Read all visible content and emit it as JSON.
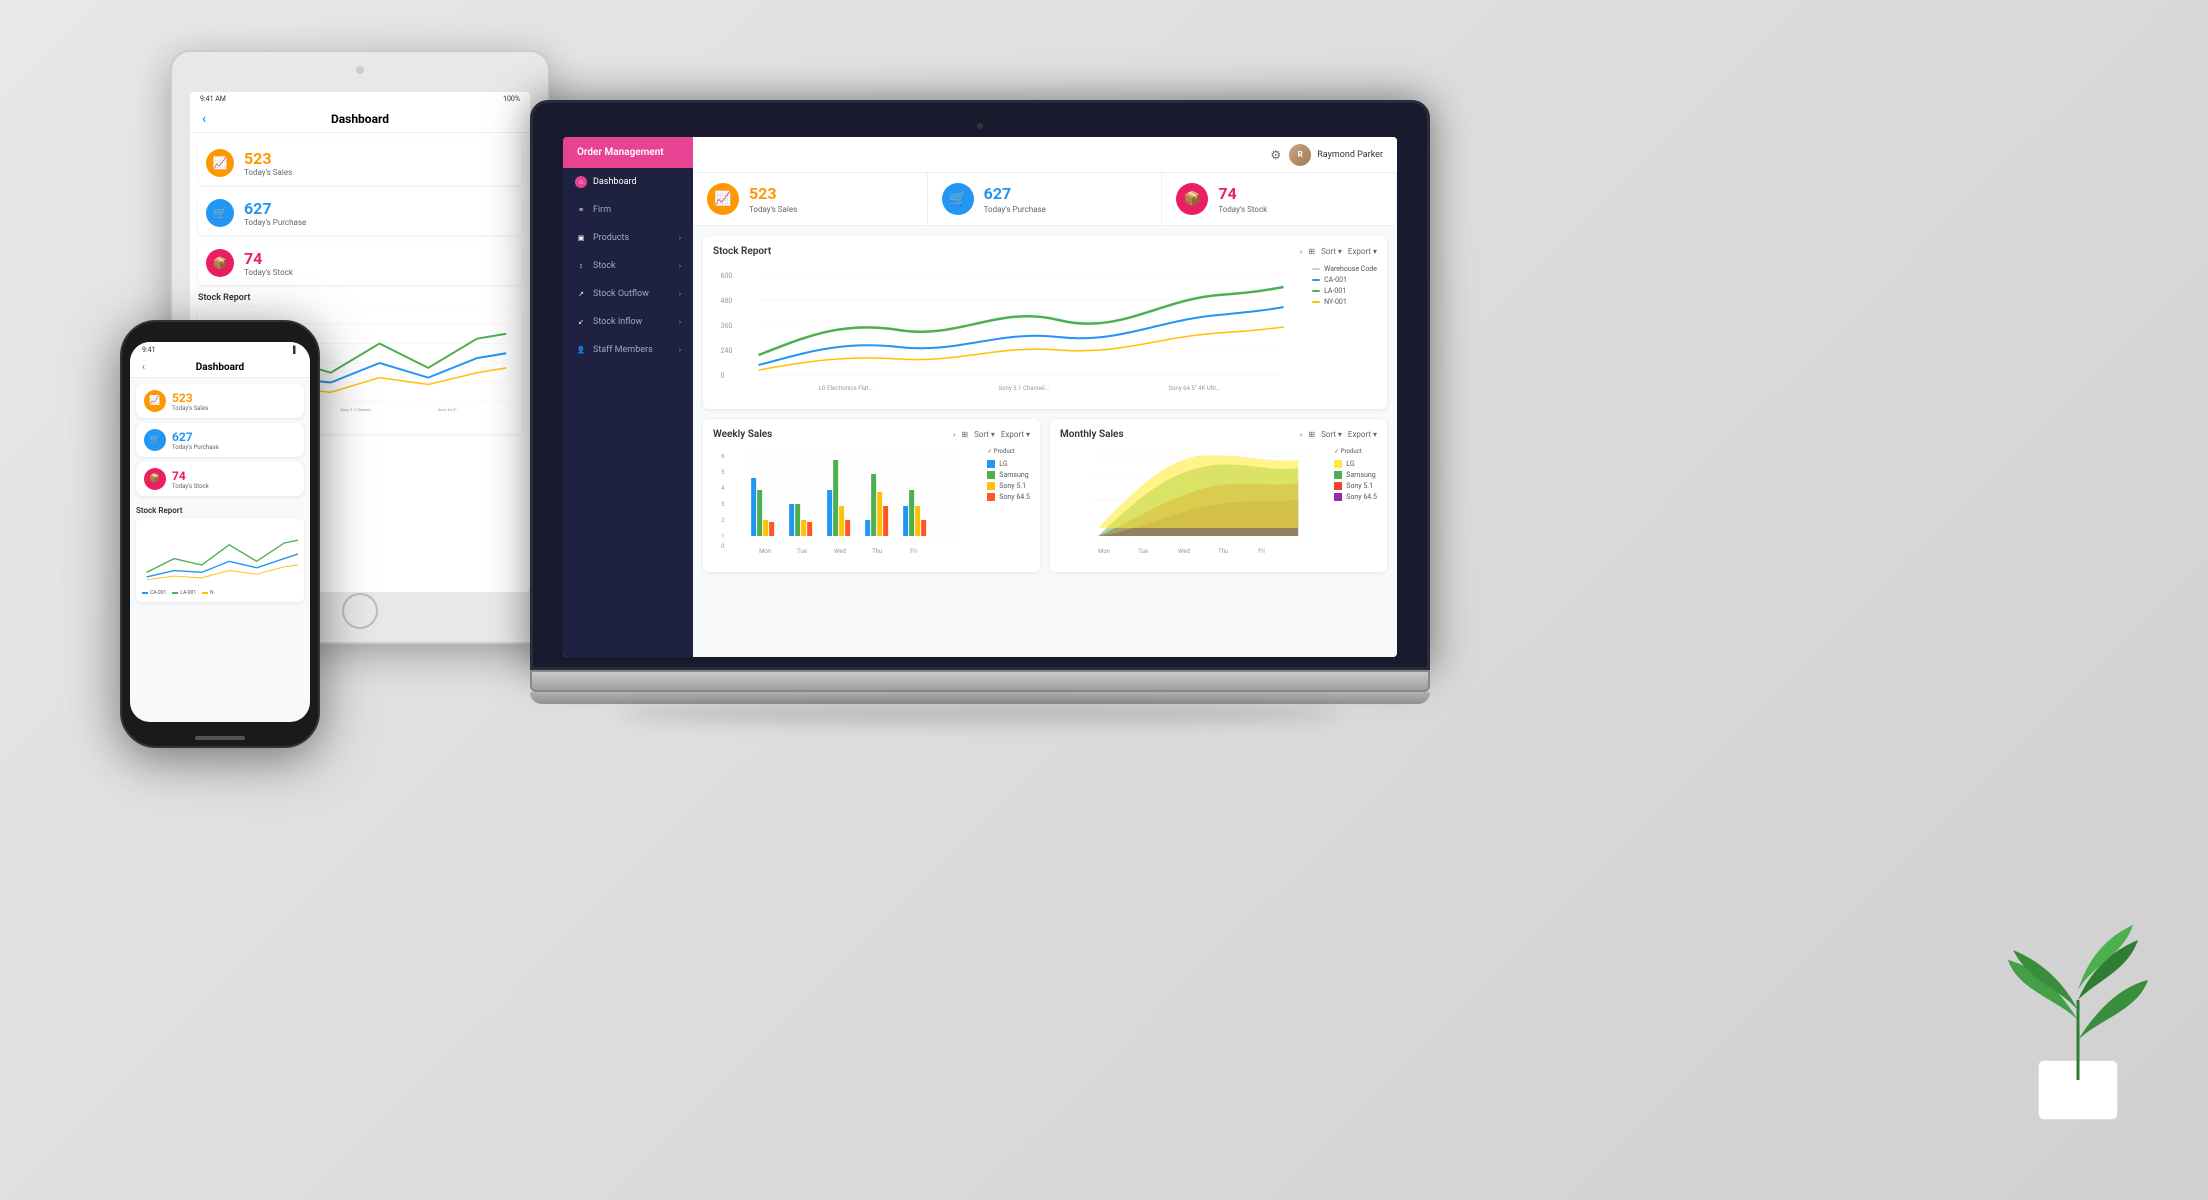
{
  "app": {
    "title": "Order Management"
  },
  "sidebar": {
    "header": "Order Management",
    "items": [
      {
        "label": "Dashboard",
        "icon": "🏠",
        "active": true
      },
      {
        "label": "Firm",
        "icon": "📋",
        "active": false
      },
      {
        "label": "Products",
        "icon": "📦",
        "active": false,
        "has_arrow": true
      },
      {
        "label": "Stock",
        "icon": "📊",
        "active": false,
        "has_arrow": true
      },
      {
        "label": "Stock Outflow",
        "icon": "📈",
        "active": false,
        "has_arrow": true
      },
      {
        "label": "Stock Inflow",
        "icon": "📉",
        "active": false,
        "has_arrow": true
      },
      {
        "label": "Staff Members",
        "icon": "👥",
        "active": false,
        "has_arrow": true
      }
    ]
  },
  "header": {
    "user_name": "Raymond Parker",
    "gear_icon": "⚙"
  },
  "stats": [
    {
      "value": "523",
      "label": "Today's Sales",
      "color": "orange",
      "icon": "📈"
    },
    {
      "value": "627",
      "label": "Today's Purchase",
      "color": "blue",
      "icon": "🛒"
    },
    {
      "value": "74",
      "label": "Today's Stock",
      "color": "pink",
      "icon": "📦"
    }
  ],
  "stock_report": {
    "title": "Stock Report",
    "sort_label": "Sort",
    "export_label": "Export",
    "y_labels": [
      "600",
      "480",
      "360",
      "240",
      "0"
    ],
    "x_labels": [
      "LG Electronics Flat...",
      "Sony 5.1 Channel...",
      "Sony 64.5\" 4K Ultr..."
    ],
    "legend": [
      {
        "label": "Warehouse Code",
        "color": "#ccc"
      },
      {
        "label": "CA-001",
        "color": "#2196f3"
      },
      {
        "label": "LA-001",
        "color": "#4caf50"
      },
      {
        "label": "NY-001",
        "color": "#ffeb3b"
      }
    ]
  },
  "weekly_sales": {
    "title": "Weekly Sales",
    "sort_label": "Sort",
    "export_label": "Export",
    "x_labels": [
      "Mon",
      "Tue",
      "Wed",
      "Thu",
      "Fri"
    ],
    "y_labels": [
      "6",
      "5",
      "4",
      "3",
      "2",
      "1",
      "0"
    ],
    "legend": [
      {
        "label": "LG",
        "color": "#2196f3"
      },
      {
        "label": "Samsung",
        "color": "#4caf50"
      },
      {
        "label": "Sony 5.1",
        "color": "#ffeb3b"
      },
      {
        "label": "Sony 64.5",
        "color": "#ff5722"
      }
    ],
    "bars": {
      "Mon": [
        4,
        3,
        1,
        1
      ],
      "Tue": [
        2,
        2,
        1,
        1
      ],
      "Wed": [
        3,
        5,
        2,
        1
      ],
      "Thu": [
        1,
        4,
        3,
        2
      ],
      "Fri": [
        2,
        3,
        2,
        1
      ]
    }
  },
  "monthly_sales": {
    "title": "Monthly Sales",
    "sort_label": "Sort",
    "export_label": "Export",
    "x_labels": [
      "Mon",
      "Tue",
      "Wed",
      "Thu",
      "Fri"
    ],
    "legend": [
      {
        "label": "LG",
        "color": "#ffeb3b"
      },
      {
        "label": "Samsung",
        "color": "#4caf50"
      },
      {
        "label": "Sony 5.1",
        "color": "#f44336"
      },
      {
        "label": "Sony 64.5",
        "color": "#9c27b0"
      }
    ]
  },
  "tablet": {
    "title": "Dashboard",
    "status_time": "9:41 AM",
    "status_battery": "100%",
    "stats": [
      {
        "value": "523",
        "label": "Today's Sales",
        "color": "#ff9800"
      },
      {
        "value": "627",
        "label": "Today's Purchase",
        "color": "#2196f3"
      },
      {
        "value": "74",
        "label": "Today's Stock",
        "color": "#e91e63"
      }
    ],
    "stock_report_label": "Stock Report"
  },
  "phone": {
    "title": "Dashboard",
    "status_time": "9:41",
    "stats": [
      {
        "value": "523",
        "label": "Today's Sales",
        "color": "#ff9800"
      },
      {
        "value": "627",
        "label": "Today's Purchase",
        "color": "#2196f3"
      },
      {
        "value": "74",
        "label": "Today's Stock",
        "color": "#e91e63"
      }
    ],
    "stock_report_label": "Stock Report"
  }
}
